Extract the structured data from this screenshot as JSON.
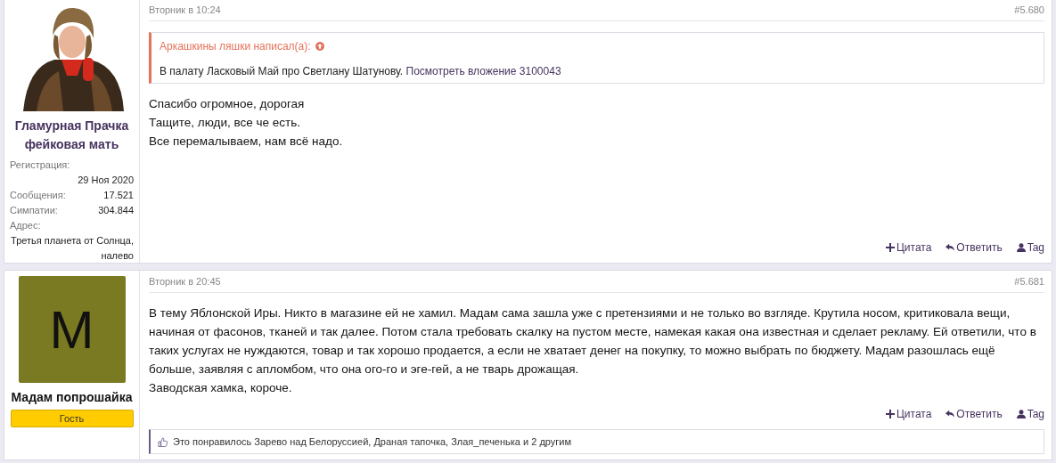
{
  "posts": [
    {
      "user": {
        "name": "Гламурная Прачка фейковая мать",
        "stats": [
          {
            "kind": "stacked",
            "label": "Регистрация:",
            "value": "29 Ноя 2020"
          },
          {
            "kind": "inline",
            "label": "Сообщения:",
            "value": "17.521"
          },
          {
            "kind": "inline",
            "label": "Симпатии:",
            "value": "304.844"
          },
          {
            "kind": "stacked",
            "label": "Адрес:",
            "value": "Третья планета от Солнца, налево"
          }
        ]
      },
      "date": "Вторник в 10:24",
      "number": "#5.680",
      "quote": {
        "author": "Аркашкины ляшки написал(а):",
        "text": "В палату Ласковый Май про Светлану Шатунову.",
        "link": "Посмотреть вложение 3100043"
      },
      "body": [
        "Спасибо огромное, дорогая",
        "Тащите, люди, все че есть.",
        "Все перемалываем, нам всё надо."
      ],
      "actions": [
        "Цитата",
        "Ответить",
        "Tag"
      ]
    },
    {
      "user": {
        "name": "Мадам попрошайка",
        "avatar": {
          "kind": "letter",
          "letter": "M",
          "color": "#7a7a22"
        },
        "badge": "Гость"
      },
      "date": "Вторник в 20:45",
      "number": "#5.681",
      "body": [
        "В тему Яблонской Иры. Никто в магазине ей не хамил. Мадам сама зашла уже с претензиями и не только во взгляде. Крутила носом, критиковала вещи, начиная от фасонов, тканей и так далее. Потом стала требовать скалку на пустом месте, намекая какая она известная и сделает рекламу. Ей ответили, что в таких услугах не нуждаются, товар и так хорошо продается, а если не хватает денег на покупку, то можно выбрать по бюджету. Мадам разошлась ещё больше, заявляя с апломбом, что она ого-го и эге-гей, а не тварь дрожащая.",
        "Заводская хамка, короче."
      ],
      "actions": [
        "Цитата",
        "Ответить",
        "Tag"
      ],
      "likes": "Это понравилось Зарево над Белоруссией, Драная тапочка, Злая_печенька и 2 другим"
    }
  ]
}
